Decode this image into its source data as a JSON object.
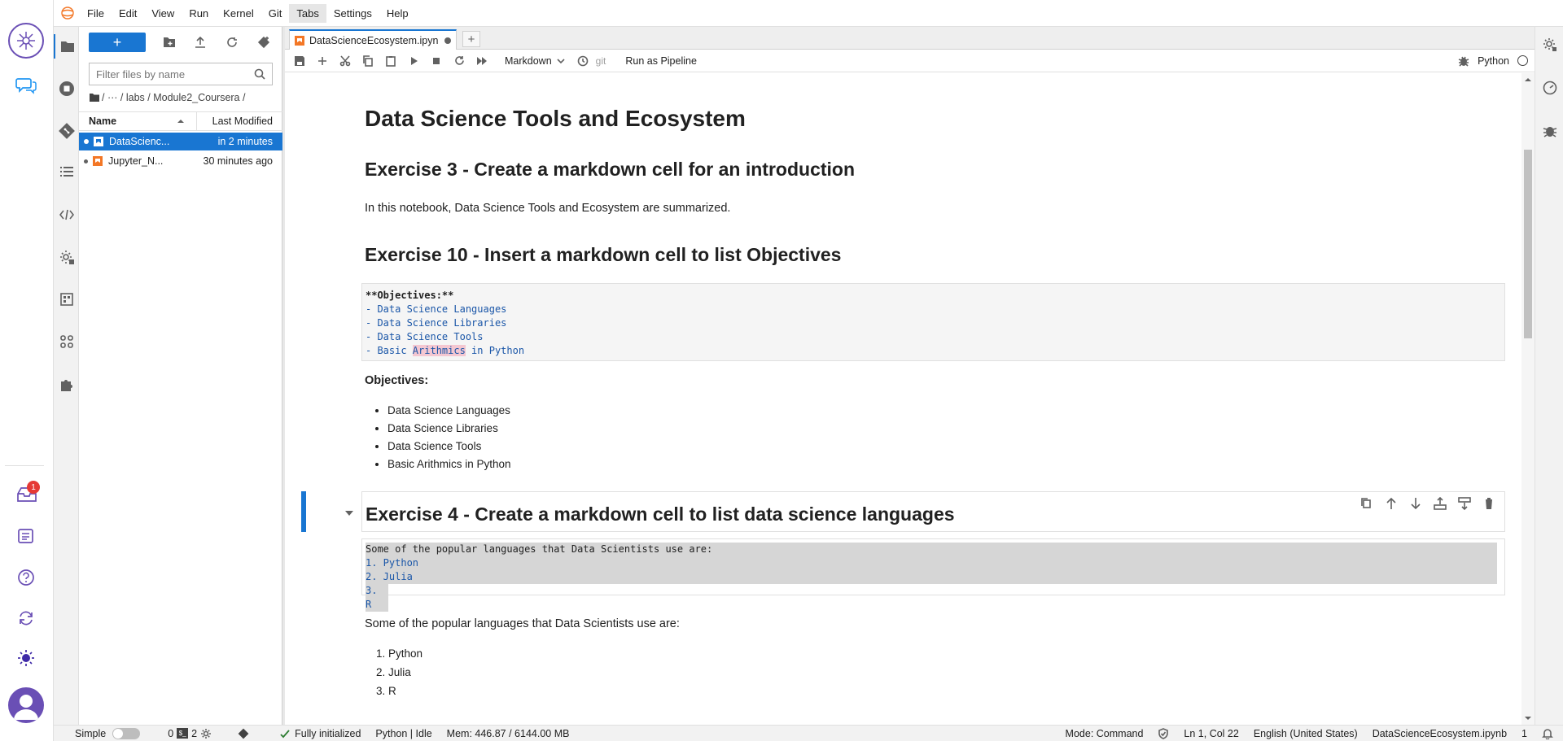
{
  "menubar": {
    "items": [
      "File",
      "Edit",
      "View",
      "Run",
      "Kernel",
      "Git",
      "Tabs",
      "Settings",
      "Help"
    ],
    "active": "Tabs"
  },
  "outer_sidebar": {
    "notification_badge": "1"
  },
  "filebrowser": {
    "new_label": "+",
    "filter_placeholder": "Filter files by name",
    "breadcrumb": "/   ···   / labs / Module2_Coursera /",
    "col_name": "Name",
    "col_modified": "Last Modified",
    "files": [
      {
        "name": "DataScienc...",
        "modified": "in 2 minutes",
        "selected": true
      },
      {
        "name": "Jupyter_N...",
        "modified": "30 minutes ago",
        "selected": false
      }
    ]
  },
  "tab": {
    "title": "DataScienceEcosystem.ipyn",
    "add_label": "+"
  },
  "toolbar": {
    "cell_type": "Markdown",
    "git_label": "git",
    "pipeline_label": "Run as Pipeline",
    "kernel_name": "Python"
  },
  "notebook": {
    "title": "Data Science Tools and Ecosystem",
    "ex3_heading": "Exercise 3 - Create a markdown cell for an introduction",
    "ex3_text": "In this notebook, Data Science Tools and Ecosystem are summarized.",
    "ex10_heading": "Exercise 10 - Insert a markdown cell to list Objectives",
    "obj_source": {
      "line0": "**Objectives:**",
      "line1": "- Data Science Languages",
      "line2": "- Data Science Libraries",
      "line3": "- Data Science Tools",
      "line4_pre": "- Basic ",
      "line4_mark": "Arithmics",
      "line4_post": " in Python"
    },
    "objectives_title": "Objectives:",
    "objectives": [
      "Data Science Languages",
      "Data Science Libraries",
      "Data Science Tools",
      "Basic Arithmics in Python"
    ],
    "ex4_heading": "Exercise 4 - Create a markdown cell to list data science languages",
    "lang_source": {
      "line0": "Some of the popular languages that Data Scientists use are:",
      "line1": "1. Python",
      "line2": "2. Julia",
      "line3": "3. R"
    },
    "lang_text": "Some of the popular languages that Data Scientists use are:",
    "languages": [
      "1. Python",
      "2. Julia",
      "3. R"
    ]
  },
  "statusbar": {
    "mode": "Simple",
    "terminals": "0",
    "kernels": "2",
    "init": "Fully initialized",
    "kernel_status": "Python | Idle",
    "memory": "Mem: 446.87 / 6144.00 MB",
    "command_mode": "Mode: Command",
    "cursor": "Ln 1, Col 22",
    "language": "English (United States)",
    "filename": "DataScienceEcosystem.ipynb",
    "notifications": "1"
  },
  "colors": {
    "accent": "#1976d2",
    "markdown_blue": "#1a56a8",
    "cell_bg": "#f5f5f5"
  }
}
